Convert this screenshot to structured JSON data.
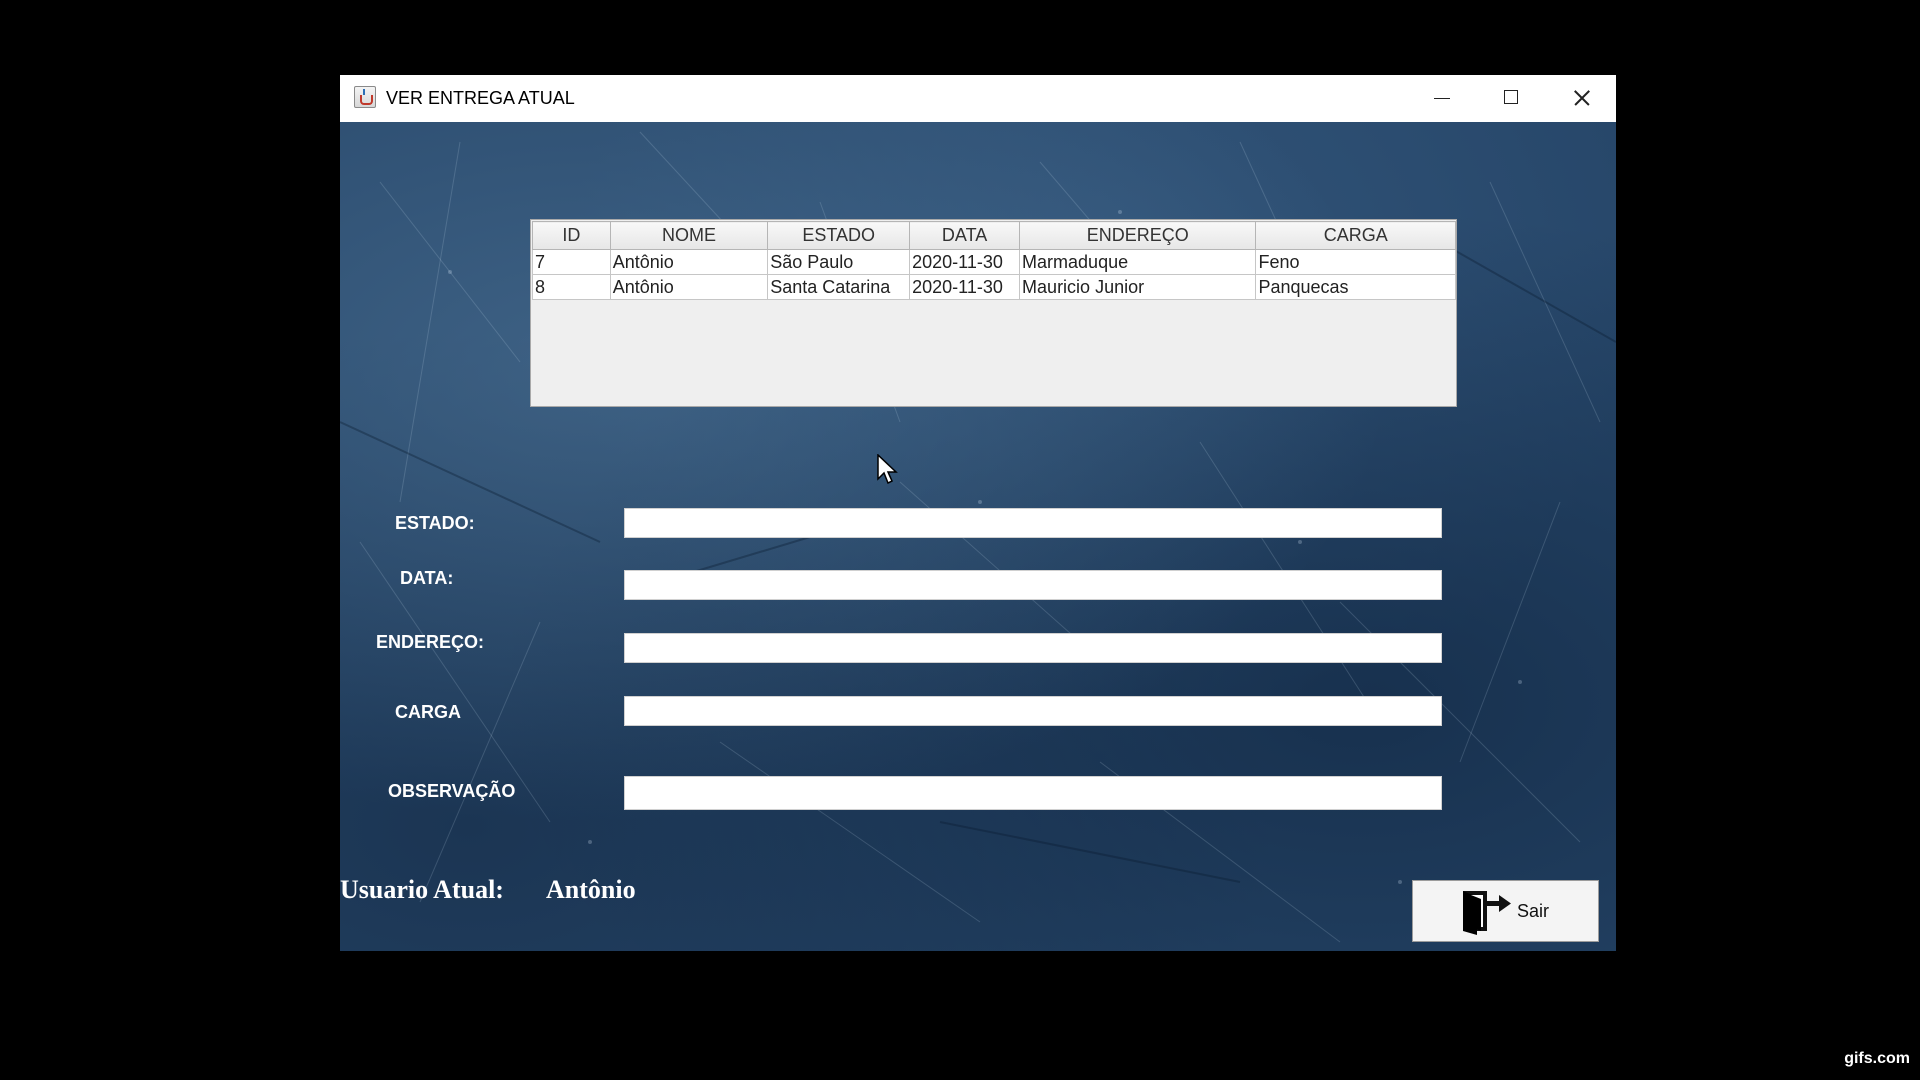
{
  "window": {
    "title": "VER ENTREGA ATUAL"
  },
  "table": {
    "columns": [
      "ID",
      "NOME",
      "ESTADO",
      "DATA",
      "ENDEREÇO",
      "CARGA"
    ],
    "rows": [
      [
        "7",
        "Antônio",
        "São Paulo",
        "2020-11-30",
        "Marmaduque",
        "Feno"
      ],
      [
        "8",
        "Antônio",
        "Santa Catarina",
        "2020-11-30",
        "Mauricio Junior",
        "Panquecas"
      ]
    ]
  },
  "form": {
    "estado_label": "ESTADO:",
    "estado_value": "",
    "data_label": "DATA:",
    "data_value": "",
    "endereco_label": "ENDEREÇO:",
    "endereco_value": "",
    "carga_label": "CARGA",
    "carga_value": "",
    "observacao_label": "OBSERVAÇÃO",
    "observacao_value": ""
  },
  "user": {
    "label": "Usuario Atual:",
    "name": "Antônio"
  },
  "buttons": {
    "exit_label": "Sair",
    "exit_icon": "exit-door-icon"
  },
  "watermark": "gifs.com",
  "colors": {
    "background": "#27476a",
    "label_text": "#ffffff"
  }
}
